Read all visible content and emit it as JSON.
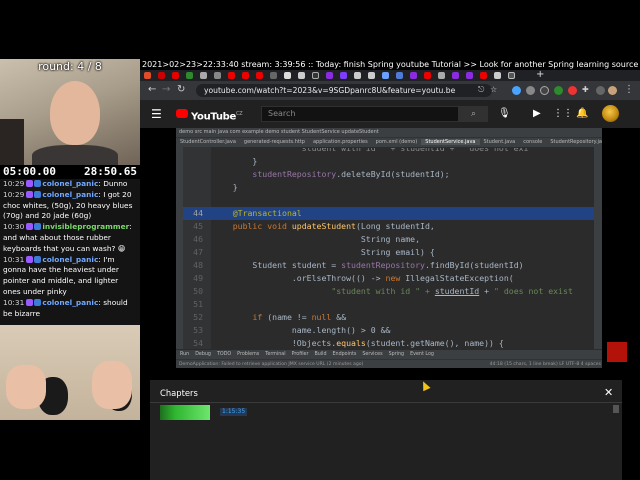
{
  "overlay": {
    "round": "round: 4 / 8",
    "timer_left": "05:00.00",
    "timer_right": "28:50.65",
    "chat": [
      {
        "time": "10:29",
        "user": "colonel_panic",
        "text": "Dunno",
        "color": "#6fa8ff"
      },
      {
        "time": "10:29",
        "user": "colonel_panic",
        "text": "I got 20 choc whites, (50g), 20 heavy blues (70g) and 20 jade (60g)",
        "color": "#6fa8ff"
      },
      {
        "time": "10:30",
        "user": "invisibleprogrammer",
        "text": "and what about those rubber keyboards that you can wash? 😁",
        "color": "#7bd86b"
      },
      {
        "time": "10:31",
        "user": "colonel_panic",
        "text": "I'm gonna have the heaviest under pointer and middle, and lighter ones under pinky",
        "color": "#6fa8ff"
      },
      {
        "time": "10:31",
        "user": "colonel_panic",
        "text": "should be bizarre",
        "color": "#6fa8ff"
      }
    ],
    "ticker": "2021>02>23>22:33:40  stream: 3:39:56  ::  Today: finish Spring youtube Tutorial >> Look for another Spring learning source / building app"
  },
  "browser": {
    "url": "youtube.com/watch?t=2023&v=9SGDpanrc8U&feature=youtu.be"
  },
  "youtube": {
    "logo": "YouTube",
    "logo_country": "CZ",
    "search_placeholder": "Search"
  },
  "ide": {
    "breadcrumbs": "demo  src  main  java  com  example  demo  student  StudentService  updateStudent",
    "tabs": [
      "StudentController.java",
      "generated-requests.http",
      "application.properties",
      "pom.xml (demo)",
      "StudentService.java",
      "Student.java",
      "console",
      "StudentRepository.java"
    ],
    "active_tab_index": 4,
    "toolwindows": [
      "Run",
      "Debug",
      "TODO",
      "Problems",
      "Terminal",
      "Profiler",
      "Build",
      "Endpoints",
      "Services",
      "Spring",
      "Event Log"
    ],
    "status_left": "DemoApplication: Failed to retrieve application JMX service URL (2 minutes ago)",
    "status_right": "44:18 (15 chars, 1 line break)   LF   UTF-8   4 spaces"
  },
  "code_lines": [
    {
      "ln": "",
      "parts": [
        {
          "t": "                  student with id \" + studentId + \" does not exi",
          "c": "dim"
        }
      ]
    },
    {
      "ln": "",
      "parts": [
        {
          "t": "        }",
          "c": ""
        }
      ]
    },
    {
      "ln": "",
      "parts": [
        {
          "t": "        studentRepository",
          "c": "fld"
        },
        {
          "t": ".deleteById(studentId);",
          "c": ""
        }
      ]
    },
    {
      "ln": "",
      "parts": [
        {
          "t": "    }",
          "c": ""
        }
      ]
    },
    {
      "ln": "",
      "parts": [
        {
          "t": "",
          "c": ""
        }
      ]
    },
    {
      "ln": "44",
      "hl": true,
      "parts": [
        {
          "t": "    @Transactional",
          "c": "ann"
        }
      ]
    },
    {
      "ln": "45",
      "parts": [
        {
          "t": "    public void ",
          "c": "kw"
        },
        {
          "t": "updateStudent",
          "c": "fn"
        },
        {
          "t": "(Long studentId,",
          "c": ""
        }
      ]
    },
    {
      "ln": "46",
      "parts": [
        {
          "t": "                              String name,",
          "c": ""
        }
      ]
    },
    {
      "ln": "47",
      "parts": [
        {
          "t": "                              String email) {",
          "c": ""
        }
      ]
    },
    {
      "ln": "48",
      "parts": [
        {
          "t": "        Student student = ",
          "c": ""
        },
        {
          "t": "studentRepository",
          "c": "fld"
        },
        {
          "t": ".findById(studentId)",
          "c": ""
        }
      ]
    },
    {
      "ln": "49",
      "parts": [
        {
          "t": "                .orElseThrow(() -> ",
          "c": ""
        },
        {
          "t": "new ",
          "c": "kw"
        },
        {
          "t": "IllegalStateException(",
          "c": ""
        }
      ]
    },
    {
      "ln": "50",
      "parts": [
        {
          "t": "                        ",
          "c": ""
        },
        {
          "t": "\"student with id \" + ",
          "c": "str"
        },
        {
          "t": "studentId",
          "c": "ul"
        },
        {
          "t": " + ",
          "c": ""
        },
        {
          "t": "\" does not exist",
          "c": "str"
        }
      ]
    },
    {
      "ln": "51",
      "parts": [
        {
          "t": "",
          "c": ""
        }
      ]
    },
    {
      "ln": "52",
      "parts": [
        {
          "t": "        ",
          "c": ""
        },
        {
          "t": "if ",
          "c": "kw"
        },
        {
          "t": "(name != ",
          "c": ""
        },
        {
          "t": "null ",
          "c": "kw"
        },
        {
          "t": "&&",
          "c": ""
        }
      ]
    },
    {
      "ln": "53",
      "parts": [
        {
          "t": "                name.length() > 0 &&",
          "c": ""
        }
      ]
    },
    {
      "ln": "54",
      "parts": [
        {
          "t": "                !Objects.",
          "c": ""
        },
        {
          "t": "equals",
          "c": "fn"
        },
        {
          "t": "(student.getName(), name)) {",
          "c": ""
        }
      ]
    }
  ],
  "chapters": {
    "title": "Chapters",
    "first_time": "1:15:35"
  }
}
